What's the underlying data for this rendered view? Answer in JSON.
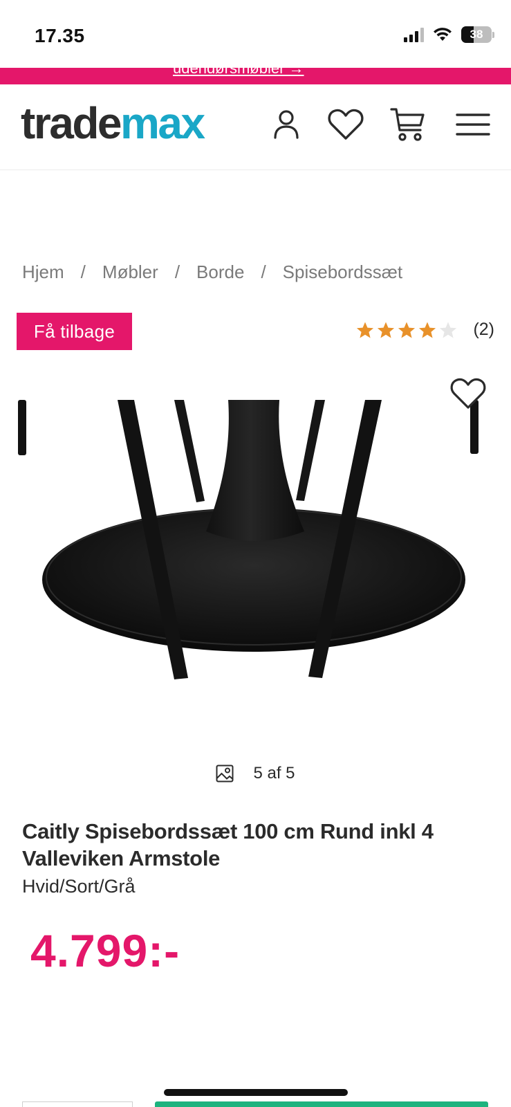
{
  "status_bar": {
    "time": "17.35",
    "battery": "38"
  },
  "promo": {
    "text": "udendørsmøbler →"
  },
  "header": {
    "logo_part1": "trade",
    "logo_part2": "max",
    "icons": [
      "account-icon",
      "heart-icon",
      "cart-icon",
      "menu-icon"
    ]
  },
  "breadcrumb": {
    "items": [
      "Hjem",
      "Møbler",
      "Borde",
      "Spisebordssæt"
    ],
    "separator": "/"
  },
  "badge": {
    "label": "Få tilbage"
  },
  "rating": {
    "value": 4,
    "max": 5,
    "count": "(2)"
  },
  "gallery": {
    "counter": "5 af 5"
  },
  "product": {
    "title": "Caitly Spisebordssæt 100 cm Rund inkl 4 Valleviken Armstole",
    "variant": "Hvid/Sort/Grå",
    "price": "4.799:-"
  },
  "colors": {
    "accent": "#e4176a",
    "logo_max": "#1aa7c7",
    "star": "#e8912a",
    "cta": "#1db37e"
  }
}
